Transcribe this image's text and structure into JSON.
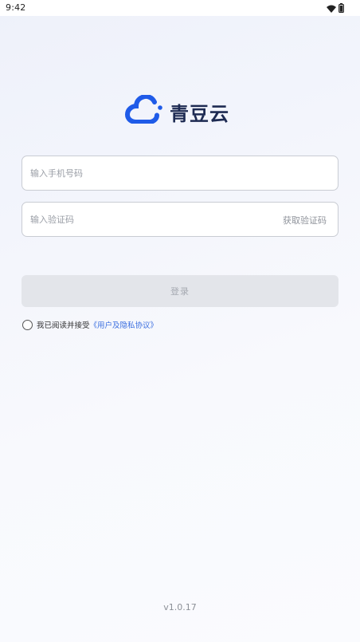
{
  "status_bar": {
    "time": "9:42",
    "icons": [
      "wifi-icon",
      "battery-icon"
    ]
  },
  "brand": {
    "name": "青豆云",
    "logo_icon": "cloud-icon",
    "logo_color": "#1f5be8",
    "text_color": "#1d2a52"
  },
  "form": {
    "phone_placeholder": "输入手机号码",
    "phone_value": "",
    "code_placeholder": "输入验证码",
    "code_value": "",
    "get_code_label": "获取验证码"
  },
  "login_button": {
    "label": "登录",
    "enabled": false
  },
  "agreement": {
    "checked": false,
    "text": "我已阅读并接受",
    "link_text": "《用户及隐私协议》",
    "link_color": "#3b6fe0"
  },
  "version": "v1.0.17"
}
